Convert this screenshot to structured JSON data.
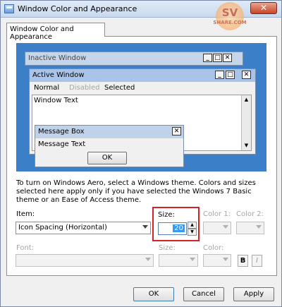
{
  "window": {
    "title": "Window Color and Appearance",
    "watermark_main": "SV",
    "watermark_sub": "SHARE.COM"
  },
  "tab": {
    "label": "Window Color and Appearance"
  },
  "preview": {
    "inactive_title": "Inactive Window",
    "active_title": "Active Window",
    "menu": {
      "normal": "Normal",
      "disabled": "Disabled",
      "selected": "Selected"
    },
    "window_text": "Window Text",
    "message_box": {
      "title": "Message Box",
      "text": "Message Text",
      "ok": "OK"
    },
    "controls": {
      "minimize": "_",
      "maximize": "□",
      "close": "✕"
    }
  },
  "description": "To turn on Windows Aero, select a Windows theme. Colors and sizes selected here apply only if you have selected the Windows 7 Basic theme or an Ease of Access theme.",
  "item": {
    "label": "Item:",
    "value": "Icon Spacing (Horizontal)"
  },
  "size": {
    "label": "Size:",
    "value": "20"
  },
  "color1": {
    "label": "Color 1:"
  },
  "color2": {
    "label": "Color 2:"
  },
  "font": {
    "label": "Font:",
    "size_label": "Size:",
    "color_label": "Color:",
    "bold": "B",
    "italic": "I"
  },
  "buttons": {
    "ok": "OK",
    "cancel": "Cancel",
    "apply": "Apply"
  }
}
